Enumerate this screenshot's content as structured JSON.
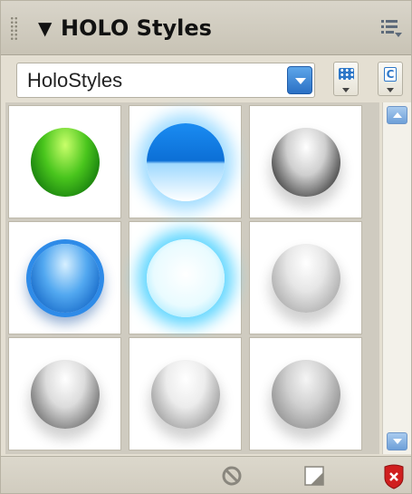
{
  "panel": {
    "title": "HOLO Styles",
    "icons": {
      "grip": "gripper-icon",
      "collapse": "collapse-triangle-icon",
      "menu": "panel-options-menu-icon"
    }
  },
  "style_selector": {
    "selected": "HoloStyles",
    "dropdown_icon": "dropdown-arrow-icon",
    "view_button_icon": "grid-view-icon",
    "custom_button_icon": "custom-styles-icon"
  },
  "swatches": [
    {
      "name": "green-gloss",
      "colors": [
        "#c9ff6a",
        "#49c51d",
        "#1f8a10",
        "#f7c400"
      ]
    },
    {
      "name": "blue-half",
      "colors": [
        "#ffffff",
        "#1a8cf2",
        "#0c6fd6",
        "#9fd9ff"
      ]
    },
    {
      "name": "chrome-dark",
      "colors": [
        "#ffffff",
        "#cfcfcf",
        "#3a3a3a",
        "#8a8a8a"
      ]
    },
    {
      "name": "blue-ring",
      "colors": [
        "#d8f0ff",
        "#52a8f0",
        "#1366c6",
        "#2e8be8"
      ]
    },
    {
      "name": "cyan-glow",
      "colors": [
        "#ffffff",
        "#e9fbff",
        "#9be8ff",
        "#5fd6ff"
      ]
    },
    {
      "name": "silver-soft",
      "colors": [
        "#ffffff",
        "#e6e6e6",
        "#a9a9a9",
        "#cfcfcf"
      ]
    },
    {
      "name": "graphite",
      "colors": [
        "#ffffff",
        "#dcdcdc",
        "#6a6a6a",
        "#3c3c3c"
      ]
    },
    {
      "name": "silver-light",
      "colors": [
        "#ffffff",
        "#ececec",
        "#9a9a9a",
        "#bdbdbd"
      ]
    },
    {
      "name": "silver-band",
      "colors": [
        "#f5f5f5",
        "#d0d0d0",
        "#8e8e8e",
        "#b8b8b8"
      ]
    }
  ],
  "scrollbar": {
    "up_icon": "scroll-up-arrow-icon",
    "down_icon": "scroll-down-arrow-icon"
  },
  "bottom_bar": {
    "icons": {
      "break_link": "break-link-icon",
      "new_style": "new-style-icon",
      "delete": "delete-style-icon"
    }
  },
  "colors": {
    "accent": "#2a6fc4",
    "panel_bg": "#e4dfd2",
    "delete_red": "#d01f1f"
  }
}
